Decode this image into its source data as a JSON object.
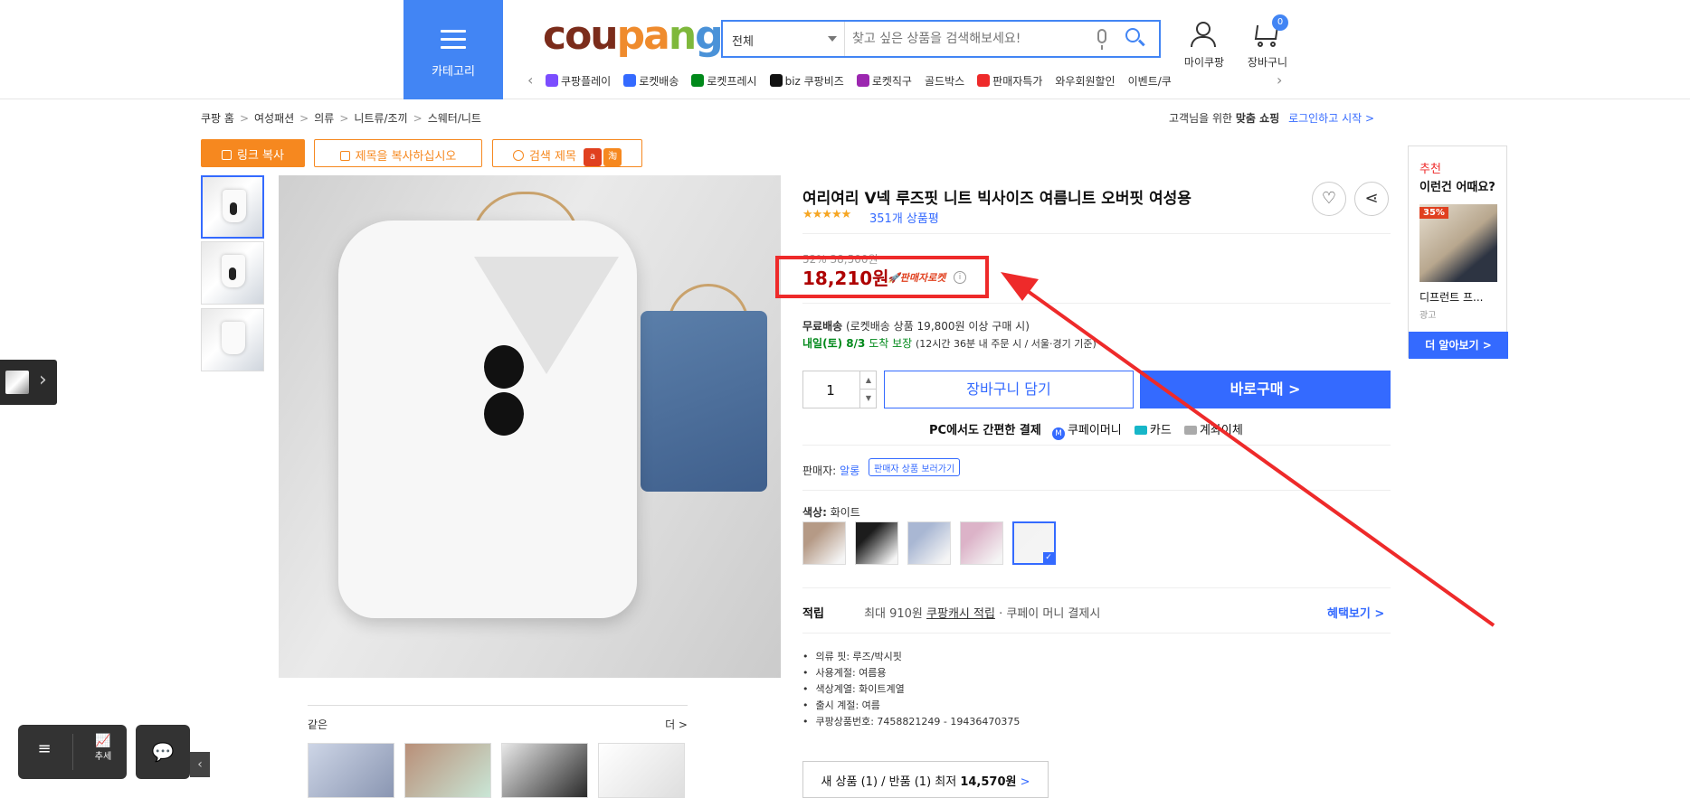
{
  "header": {
    "category_label": "카테고리",
    "logo": "coupang",
    "search": {
      "scope": "전체",
      "placeholder": "찾고 싶은 상품을 검색해보세요!"
    },
    "my_page": "마이쿠팡",
    "cart": "장바구니",
    "cart_count": "0"
  },
  "gnb": [
    {
      "label": "쿠팡플레이",
      "color": "#7b4dff"
    },
    {
      "label": "로켓배송",
      "color": "#346aff"
    },
    {
      "label": "로켓프레시",
      "color": "#00891a"
    },
    {
      "label": "biz 쿠팡비즈",
      "color": "#111111"
    },
    {
      "label": "로켓직구",
      "color": "#9c27b0"
    },
    {
      "label": "골드박스",
      "color": ""
    },
    {
      "label": "판매자특가",
      "color": "#ee2a2a"
    },
    {
      "label": "와우회원할인",
      "color": ""
    },
    {
      "label": "이벤트/쿠",
      "color": ""
    }
  ],
  "breadcrumb": [
    "쿠팡 홈",
    "여성패션",
    "의류",
    "니트류/조끼",
    "스웨터/니트"
  ],
  "login_prompt": {
    "text": "고객님을 위한",
    "bold": "맞춤 쇼핑",
    "link": "로그인하고 시작 >"
  },
  "extension_buttons": {
    "copy_link": "링크 복사",
    "copy_title": "제목을 복사하십시오",
    "search_title": "검색 제목"
  },
  "product": {
    "title": "여리여리 V넥 루즈핏 니트 빅사이즈 여름니트 오버핏 여성용",
    "stars": "★★★★★",
    "rating_count": "351개 상품평",
    "original_price": "52% 38,500원",
    "sale_price": "18,210원",
    "rocket_badge": "판매자로켓",
    "shipping_free": "무료배송",
    "shipping_note": "(로켓배송 상품 19,800원 이상 구매 시)",
    "delivery_day": "내일(토) 8/3",
    "delivery_text": "도착 보장",
    "delivery_cond": "(12시간 36분  내 주문 시 / 서울·경기 기준)",
    "quantity": "1",
    "add_to_cart": "장바구니 담기",
    "buy_now": "바로구매 >",
    "pc_pay_label": "PC에서도 간편한 결제",
    "pay_methods": [
      "쿠페이머니",
      "카드",
      "계좌이체"
    ],
    "seller_label": "판매자:",
    "seller_name": "알롱",
    "seller_button": "판매자 상품 보러가기",
    "color_label": "색상:",
    "color_value": "화이트",
    "swatches": [
      {
        "name": "beige",
        "color": "#b59a86"
      },
      {
        "name": "black",
        "color": "#1c1c1c"
      },
      {
        "name": "sky",
        "color": "#a9b7d3"
      },
      {
        "name": "pink",
        "color": "#dcb3c8"
      },
      {
        "name": "white",
        "color": "#f3f3f3"
      }
    ],
    "reward_label": "적립",
    "reward_text": "최대 910원",
    "reward_link": "쿠팡캐시 적립",
    "reward_suffix": "· 쿠페이 머니 결제시",
    "benefit_link": "혜택보기 >",
    "attributes": [
      "의류 핏: 루즈/박시핏",
      "사용계절: 여름용",
      "색상계열: 화이트계열",
      "출시 계절: 여름",
      "쿠팡상품번호: 7458821249 - 19436470375"
    ],
    "new_used": {
      "prefix": "새 상품 (1) / 반품 (1) 최저",
      "price": "14,570원",
      "arrow": ">"
    }
  },
  "similar": {
    "header": "같은",
    "more": "더 >"
  },
  "recommend": {
    "title_red": "추천",
    "title": "이런건 어때요?",
    "discount": "35%",
    "product_name": "디프런트 프...",
    "ad": "광고",
    "more": "더 알아보기 >"
  },
  "bottom_nav": {
    "trend": "추세"
  },
  "colors": {
    "accent": "#346aff",
    "highlight": "#ee2a2a",
    "price": "#ae0000",
    "extension": "#f6881f"
  }
}
